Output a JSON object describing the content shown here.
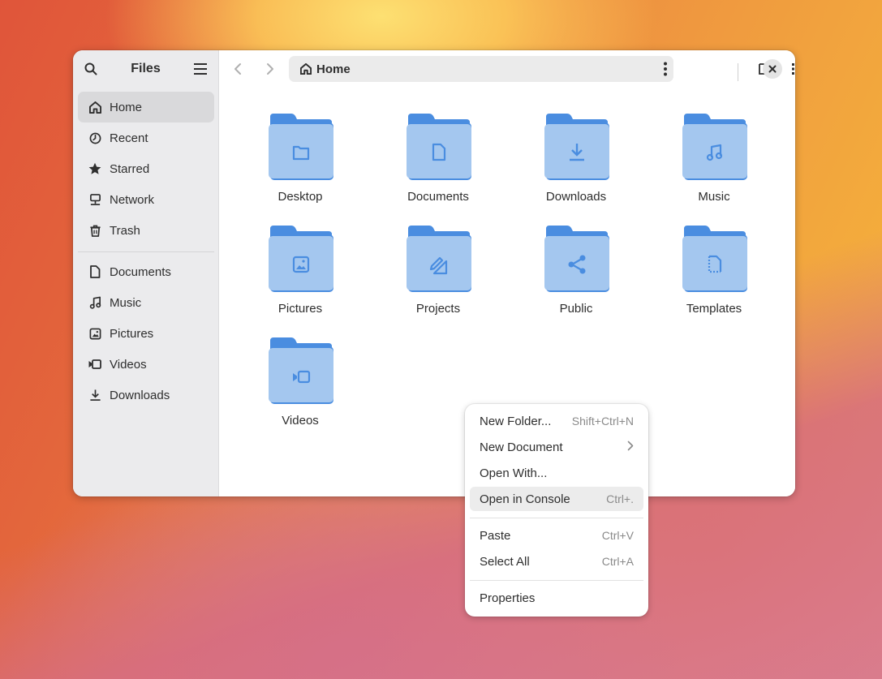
{
  "window": {
    "sidebar_title": "Files",
    "path": "Home"
  },
  "sidebar": {
    "places": [
      {
        "label": "Home",
        "icon": "home-icon",
        "active": true
      },
      {
        "label": "Recent",
        "icon": "clock-icon"
      },
      {
        "label": "Starred",
        "icon": "star-icon"
      },
      {
        "label": "Network",
        "icon": "network-icon"
      },
      {
        "label": "Trash",
        "icon": "trash-icon"
      }
    ],
    "bookmarks": [
      {
        "label": "Documents",
        "icon": "document-icon"
      },
      {
        "label": "Music",
        "icon": "music-icon"
      },
      {
        "label": "Pictures",
        "icon": "picture-icon"
      },
      {
        "label": "Videos",
        "icon": "video-icon"
      },
      {
        "label": "Downloads",
        "icon": "download-icon"
      }
    ]
  },
  "folders": [
    {
      "label": "Desktop",
      "icon": "folder-icon"
    },
    {
      "label": "Documents",
      "icon": "document-icon"
    },
    {
      "label": "Downloads",
      "icon": "download-icon"
    },
    {
      "label": "Music",
      "icon": "music-icon"
    },
    {
      "label": "Pictures",
      "icon": "picture-icon"
    },
    {
      "label": "Projects",
      "icon": "pencil-ruler-icon"
    },
    {
      "label": "Public",
      "icon": "share-icon"
    },
    {
      "label": "Templates",
      "icon": "template-icon"
    },
    {
      "label": "Videos",
      "icon": "video-icon"
    }
  ],
  "context_menu": {
    "items": [
      {
        "label": "New Folder...",
        "accel": "Shift+Ctrl+N"
      },
      {
        "label": "New Document",
        "accel": ""
      },
      {
        "label": "Open With...",
        "accel": ""
      },
      {
        "label": "Open in Console",
        "accel": "Ctrl+.",
        "highlighted": true
      },
      {
        "label": "Paste",
        "accel": "Ctrl+V"
      },
      {
        "label": "Select All",
        "accel": "Ctrl+A"
      },
      {
        "label": "Properties",
        "accel": ""
      }
    ]
  },
  "colors": {
    "folder_body": "#a4c7ef",
    "folder_tab": "#4a8de0",
    "folder_glyph": "#4a8de0",
    "sidebar_bg": "#ebebed",
    "active_item": "#d9d9db"
  }
}
